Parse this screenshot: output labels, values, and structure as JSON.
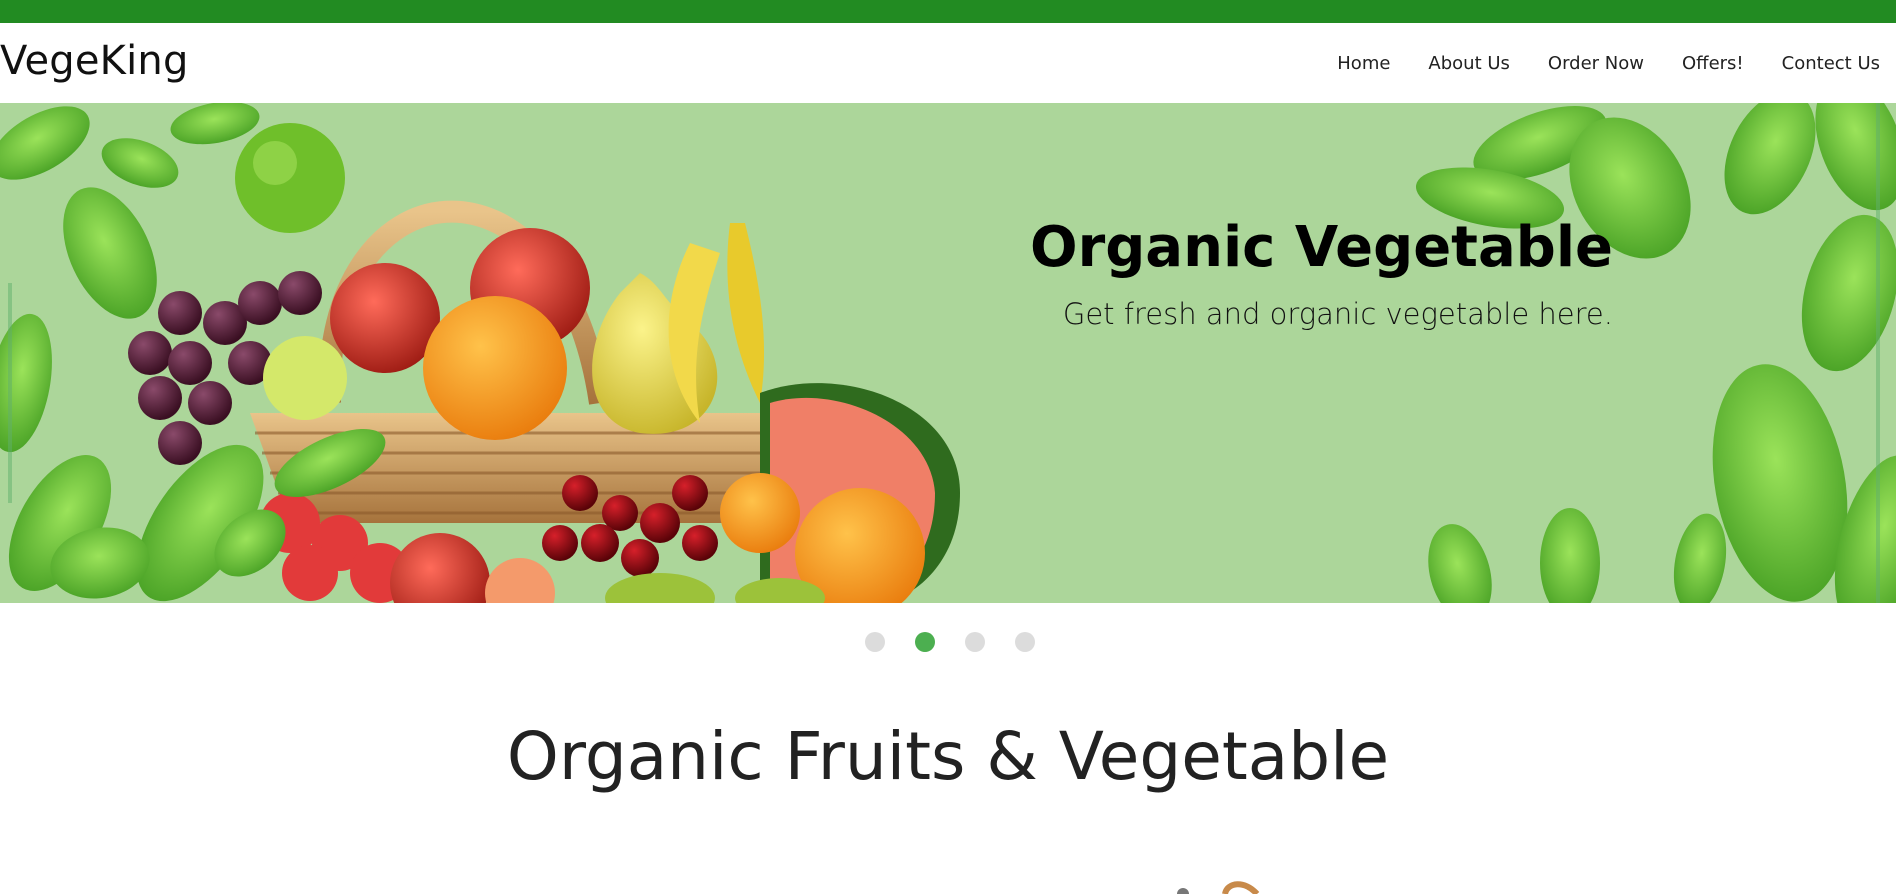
{
  "brand": {
    "name": "VegeKing"
  },
  "nav": {
    "items": [
      {
        "label": "Home"
      },
      {
        "label": "About Us"
      },
      {
        "label": "Order Now"
      },
      {
        "label": "Offers!"
      },
      {
        "label": "Contect Us"
      }
    ]
  },
  "hero": {
    "title": "Organic Vegetable",
    "subtitle": "Get fresh and organic vegetable here.",
    "image": "fruit-basket-with-leaves"
  },
  "carousel": {
    "slide_count": 4,
    "active_index": 1
  },
  "section": {
    "title": "Organic Fruits & Vegetable"
  },
  "colors": {
    "topbar": "#228b22",
    "hero_bg": "#acd69a",
    "dot_active": "#4caf50",
    "dot_inactive": "#dcdcdc"
  }
}
